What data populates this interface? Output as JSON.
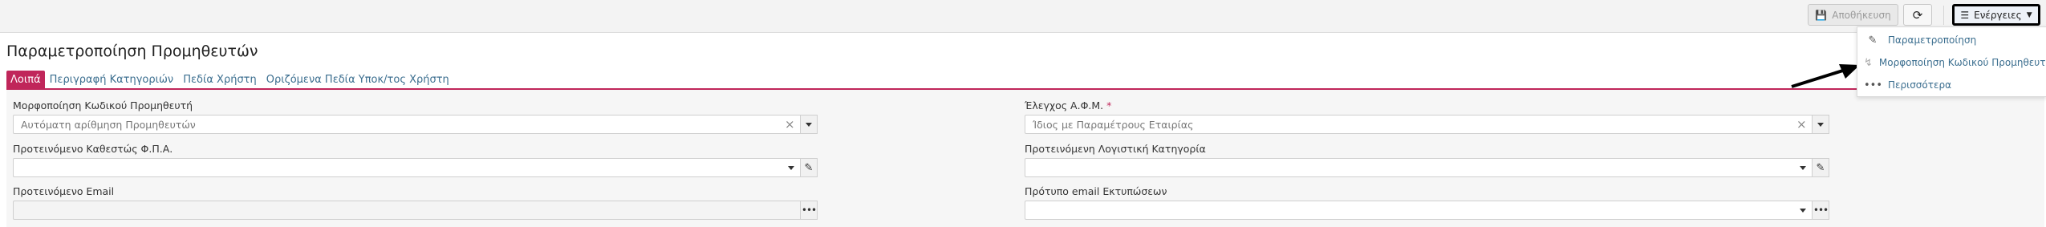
{
  "toolbar": {
    "save_label": "Αποθήκευση",
    "refresh_icon": "refresh-icon",
    "actions_label": "Ενέργειες"
  },
  "page": {
    "title": "Παραμετροποίηση Προμηθευτών"
  },
  "tabs": [
    {
      "label": "Λοιπά",
      "active": true
    },
    {
      "label": "Περιγραφή Κατηγοριών",
      "active": false
    },
    {
      "label": "Πεδία Χρήστη",
      "active": false
    },
    {
      "label": "Οριζόμενα Πεδία Υποκ/τος Χρήστη",
      "active": false
    }
  ],
  "form": {
    "supplier_code_format": {
      "label": "Μορφοποίηση Κωδικού Προμηθευτή",
      "value": "Αυτόματη αρίθμηση Προμηθευτών"
    },
    "vat_check": {
      "label": "Έλεγχος Α.Φ.Μ.",
      "required_mark": "*",
      "value": "Ίδιος με Παραμέτρους Εταιρίας"
    },
    "default_vat_status": {
      "label": "Προτεινόμενο Καθεστώς Φ.Π.Α.",
      "value": ""
    },
    "default_accounting_category": {
      "label": "Προτεινόμενη Λογιστική Κατηγορία",
      "value": ""
    },
    "default_email": {
      "label": "Προτεινόμενο Email",
      "value": ""
    },
    "print_email_template": {
      "label": "Πρότυπο email Εκτυπώσεων",
      "value": ""
    }
  },
  "actions_menu": {
    "items": [
      {
        "label": "Παραμετροποίηση",
        "icon": "edit-icon"
      },
      {
        "label": "Μορφοποίηση Κωδικού Προμηθευτή",
        "icon": "bolt-icon"
      },
      {
        "label": "Περισσότερα",
        "icon": "more-icon"
      }
    ]
  },
  "colors": {
    "accent": "#c0265a",
    "link": "#3b6e8f"
  }
}
